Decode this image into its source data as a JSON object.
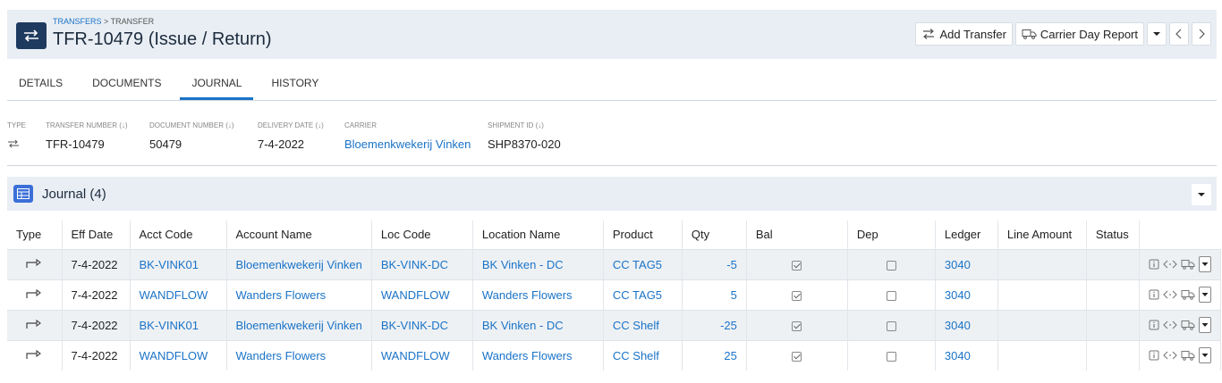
{
  "header": {
    "breadcrumb_link": "TRANSFERS",
    "breadcrumb_sep": " > ",
    "breadcrumb_current": "TRANSFER",
    "title": "TFR-10479 (Issue / Return)",
    "actions": {
      "add_transfer": "Add Transfer",
      "carrier_day_report": "Carrier Day Report"
    }
  },
  "tabs": [
    {
      "label": "DETAILS",
      "active": false
    },
    {
      "label": "DOCUMENTS",
      "active": false
    },
    {
      "label": "JOURNAL",
      "active": true
    },
    {
      "label": "HISTORY",
      "active": false
    }
  ],
  "info": {
    "type_label": "TYPE",
    "transfer_number_label": "TRANSFER NUMBER (↓)",
    "transfer_number": "TFR-10479",
    "document_number_label": "DOCUMENT NUMBER (↓)",
    "document_number": "50479",
    "delivery_date_label": "DELIVERY DATE (↓)",
    "delivery_date": "7-4-2022",
    "carrier_label": "CARRIER",
    "carrier": "Bloemenkwekerij Vinken",
    "shipment_id_label": "SHIPMENT ID (↓)",
    "shipment_id": "SHP8370-020"
  },
  "journal": {
    "title": "Journal",
    "count": "(4)",
    "columns": [
      "Type",
      "Eff Date",
      "Acct Code",
      "Account Name",
      "Loc Code",
      "Location Name",
      "Product",
      "Qty",
      "Bal",
      "Dep",
      "Ledger",
      "Line Amount",
      "Status",
      ""
    ],
    "rows": [
      {
        "eff_date": "7-4-2022",
        "acct_code": "BK-VINK01",
        "account_name": "Bloemenkwekerij Vinken",
        "loc_code": "BK-VINK-DC",
        "location_name": "BK Vinken - DC",
        "product": "CC TAG5",
        "qty": "-5",
        "bal": true,
        "dep": false,
        "ledger": "3040",
        "line_amount": "",
        "status": ""
      },
      {
        "eff_date": "7-4-2022",
        "acct_code": "WANDFLOW",
        "account_name": "Wanders Flowers",
        "loc_code": "WANDFLOW",
        "location_name": "Wanders Flowers",
        "product": "CC TAG5",
        "qty": "5",
        "bal": true,
        "dep": false,
        "ledger": "3040",
        "line_amount": "",
        "status": ""
      },
      {
        "eff_date": "7-4-2022",
        "acct_code": "BK-VINK01",
        "account_name": "Bloemenkwekerij Vinken",
        "loc_code": "BK-VINK-DC",
        "location_name": "BK Vinken - DC",
        "product": "CC Shelf",
        "qty": "-25",
        "bal": true,
        "dep": false,
        "ledger": "3040",
        "line_amount": "",
        "status": ""
      },
      {
        "eff_date": "7-4-2022",
        "acct_code": "WANDFLOW",
        "account_name": "Wanders Flowers",
        "loc_code": "WANDFLOW",
        "location_name": "Wanders Flowers",
        "product": "CC Shelf",
        "qty": "25",
        "bal": true,
        "dep": false,
        "ledger": "3040",
        "line_amount": "",
        "status": ""
      }
    ]
  },
  "colors": {
    "accent": "#1a73c7",
    "header_bg": "#e9eef4",
    "badge_bg": "#1f3a5f",
    "table_icon_bg": "#3b6fd8"
  },
  "icons": {
    "type_badge": "transfer-arrows-icon",
    "row_type": "issue-arrow-icon",
    "row_actions": [
      "info-icon",
      "code-icon",
      "truck-icon",
      "chevron-down-icon"
    ]
  }
}
